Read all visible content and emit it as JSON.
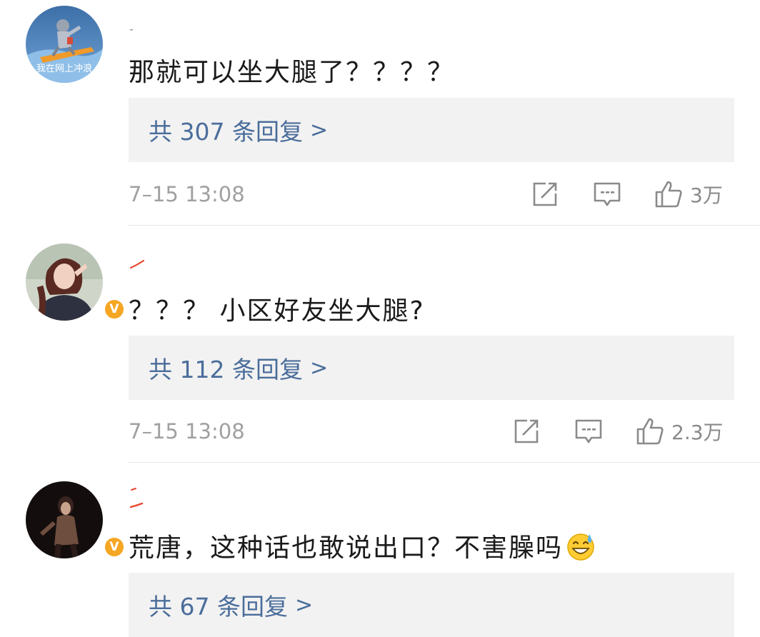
{
  "comments": [
    {
      "avatar_caption": "我在网上冲浪",
      "text": "那就可以坐大腿了？？？？",
      "replies_label": "共 307 条回复",
      "replies_chevron": ">",
      "time": "7–15 13:08",
      "likes": "3万",
      "verified": false
    },
    {
      "avatar_caption": "",
      "text": "？？？ 小区好友坐大腿?",
      "replies_label": "共 112 条回复",
      "replies_chevron": ">",
      "time": "7–15 13:08",
      "likes": "2.3万",
      "verified": true
    },
    {
      "avatar_caption": "",
      "text": "荒唐，这种话也敢说出口？不害臊吗",
      "emoji": "grinning-sweat-emoji",
      "replies_label": "共 67 条回复",
      "replies_chevron": ">",
      "verified": true
    }
  ],
  "icons": {
    "share": "share-icon",
    "comment": "comment-icon",
    "like": "thumbs-up-icon",
    "verified": "verified-v-badge"
  },
  "colors": {
    "link": "#4a6d9b",
    "reply_bg": "#f2f2f2",
    "meta": "#a0a0a0",
    "badge": "#f5a623",
    "username_mark": "#e8452c"
  },
  "badge_letter": "V"
}
